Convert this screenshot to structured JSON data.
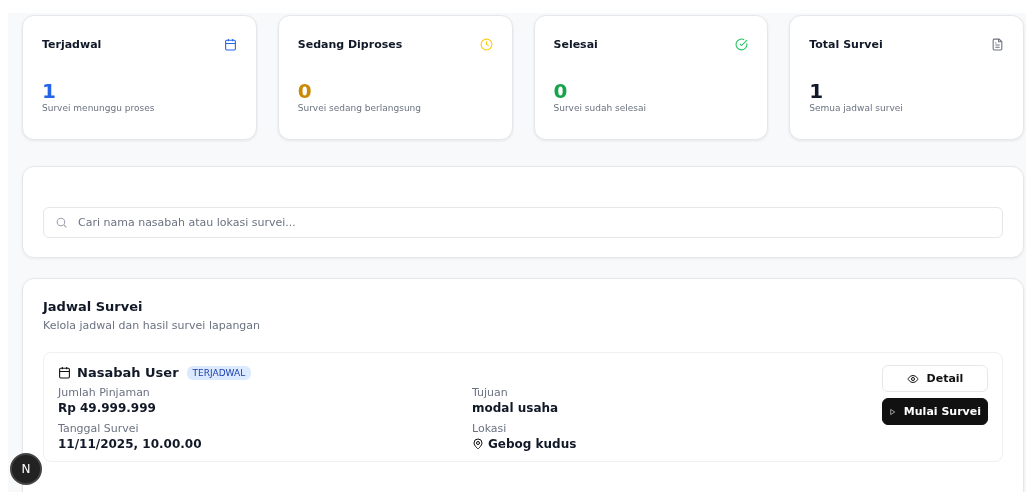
{
  "stats": [
    {
      "kind": "calendar",
      "label": "Terjadwal",
      "value": "1",
      "caption": "Survei menunggu proses",
      "color": "#2563eb"
    },
    {
      "kind": "clock",
      "label": "Sedang Diproses",
      "value": "0",
      "caption": "Survei sedang berlangsung",
      "color": "#ca8a04"
    },
    {
      "kind": "check",
      "label": "Selesai",
      "value": "0",
      "caption": "Survei sudah selesai",
      "color": "#16a34a"
    },
    {
      "kind": "file",
      "label": "Total Survei",
      "value": "1",
      "caption": "Semua jadwal survei",
      "color": "#111827"
    }
  ],
  "search": {
    "placeholder": "Cari nama nasabah atau lokasi survei..."
  },
  "schedule": {
    "title": "Jadwal Survei",
    "subtitle": "Kelola jadwal dan hasil survei lapangan",
    "items": [
      {
        "name": "Nasabah User",
        "status": "TERJADWAL",
        "fields": [
          {
            "label": "Jumlah Pinjaman",
            "value": "Rp 49.999.999"
          },
          {
            "label": "Tujuan",
            "value": "modal usaha"
          },
          {
            "label": "Tanggal Survei",
            "value": "11/11/2025, 10.00.00"
          },
          {
            "label": "Lokasi",
            "value": "Gebog kudus",
            "kind": "location"
          }
        ],
        "buttons": [
          {
            "kind": "view",
            "label": "Detail"
          },
          {
            "kind": "start",
            "label": "Mulai Survei"
          }
        ]
      }
    ]
  },
  "dev_badge": "N"
}
